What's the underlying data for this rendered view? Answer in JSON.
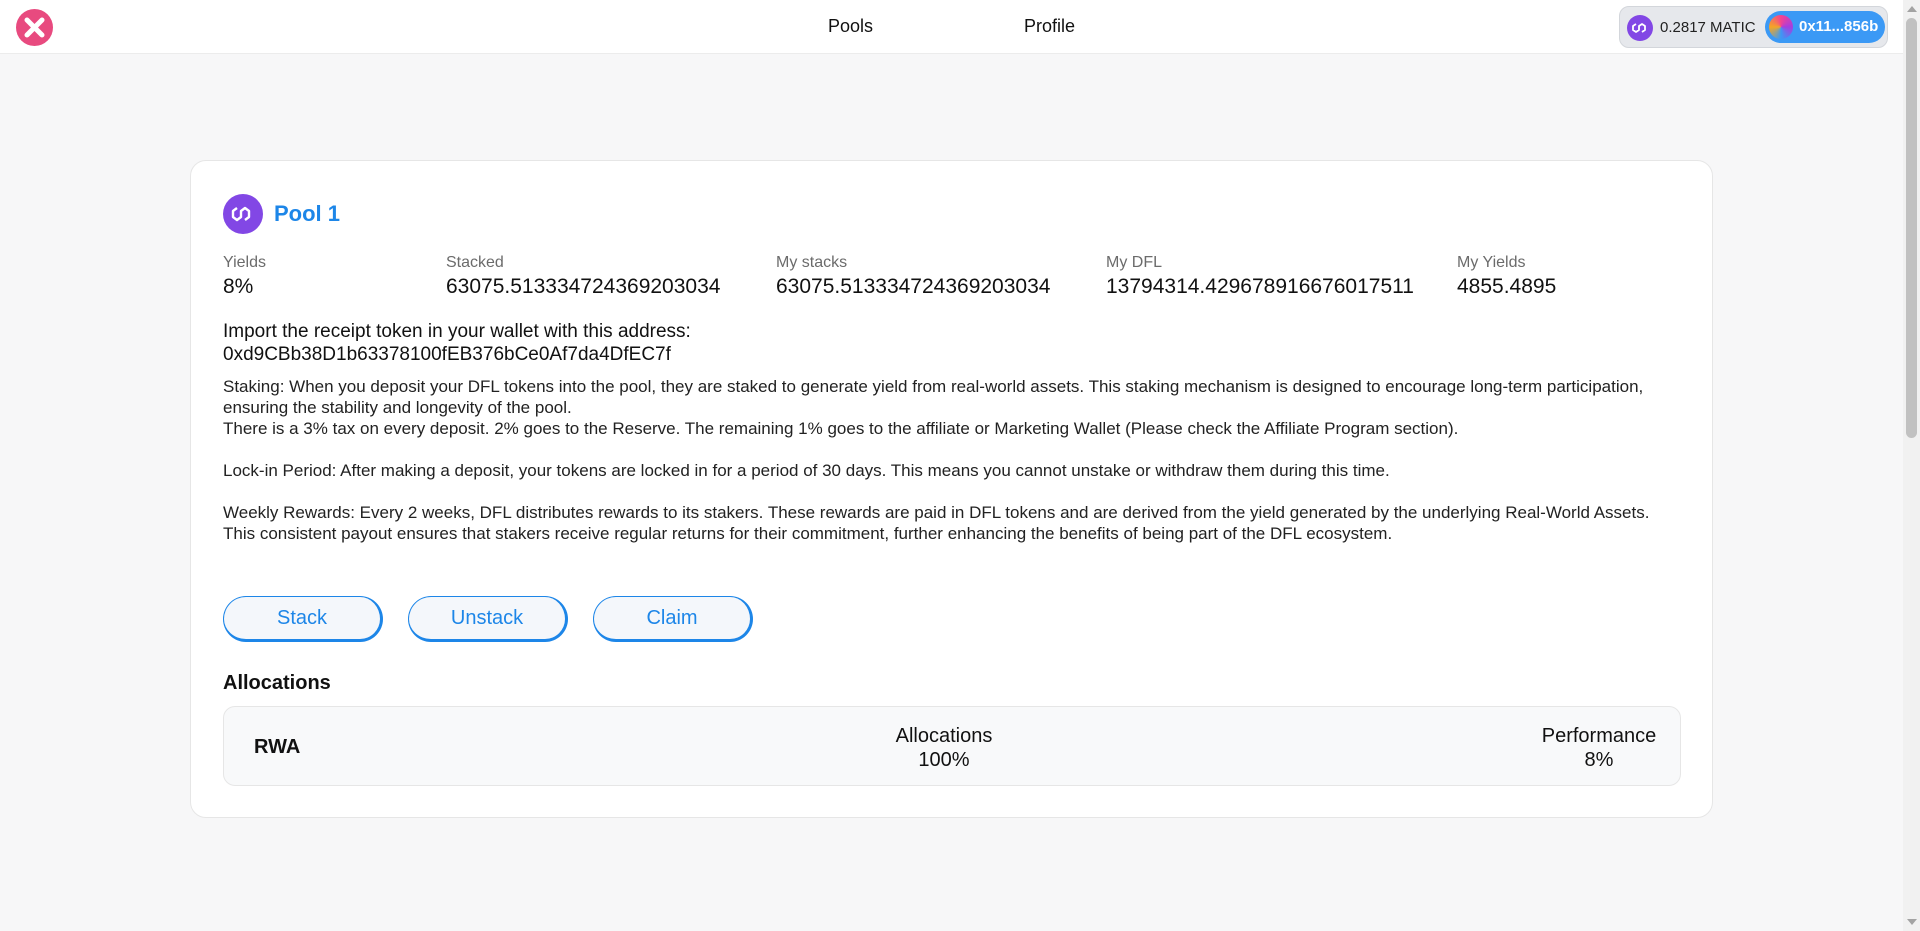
{
  "header": {
    "logo_icon": "x-circle-icon",
    "nav": [
      {
        "label": "Pools"
      },
      {
        "label": "Profile"
      }
    ],
    "wallet": {
      "network_icon": "polygon-matic-icon",
      "balance": "0.2817 MATIC",
      "account": "0x11...856b"
    }
  },
  "pool": {
    "icon": "polygon-icon",
    "title": "Pool 1",
    "stats": [
      {
        "label": "Yields",
        "value": "8%"
      },
      {
        "label": "Stacked",
        "value": "63075.513334724369203034"
      },
      {
        "label": "My stacks",
        "value": "63075.513334724369203034"
      },
      {
        "label": "My DFL",
        "value": "13794314.429678916676017511"
      },
      {
        "label": "My Yields",
        "value": "4855.4895"
      }
    ],
    "import_label": "Import the receipt token in your wallet with this address:",
    "import_address": "0xd9CBb38D1b63378100fEB376bCe0Af7da4DfEC7f",
    "description": {
      "staking": "Staking: When you deposit your DFL tokens into the pool, they are staked to generate yield from real-world assets. This staking mechanism is designed to encourage long-term participation, ensuring the stability and longevity of the pool.",
      "tax": "There is a 3% tax on every deposit. 2% goes to the Reserve. The remaining 1% goes to the affiliate or Marketing Wallet (Please check the Affiliate Program section).",
      "lock": "Lock-in Period: After making a deposit, your tokens are locked in for a period of 30 days. This means you cannot unstake or withdraw them during this time.",
      "rewards": "Weekly Rewards: Every 2 weeks, DFL distributes rewards to its stakers. These rewards are paid in DFL tokens and are derived from the yield generated by the underlying Real-World Assets. This consistent payout ensures that stakers receive regular returns for their commitment, further enhancing the benefits of being part of the DFL ecosystem."
    },
    "buttons": {
      "stack": "Stack",
      "unstack": "Unstack",
      "claim": "Claim"
    },
    "allocations": {
      "heading": "Allocations",
      "row": {
        "name": "RWA",
        "allocations_label": "Allocations",
        "allocations_value": "100%",
        "performance_label": "Performance",
        "performance_value": "8%"
      }
    }
  },
  "colors": {
    "accent": "#1d86e8",
    "logo": "#e84a7f",
    "polygon": "#8247e5",
    "account_button": "#3b99f5"
  }
}
